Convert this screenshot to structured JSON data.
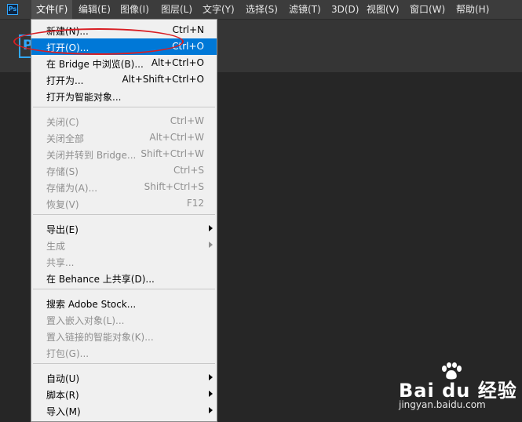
{
  "menubar": {
    "logo": "Ps",
    "items": [
      "文件(F)",
      "编辑(E)",
      "图像(I)",
      "图层(L)",
      "文字(Y)",
      "选择(S)",
      "滤镜(T)",
      "3D(D)",
      "视图(V)",
      "窗口(W)",
      "帮助(H)"
    ]
  },
  "home_icon_letter": "P",
  "file_menu": {
    "items": [
      {
        "label": "新建(N)...",
        "shortcut": "Ctrl+N",
        "state": "enabled"
      },
      {
        "label": "打开(O)...",
        "shortcut": "Ctrl+O",
        "state": "highlighted"
      },
      {
        "label": "在 Bridge 中浏览(B)...",
        "shortcut": "Alt+Ctrl+O",
        "state": "enabled"
      },
      {
        "label": "打开为...",
        "shortcut": "Alt+Shift+Ctrl+O",
        "state": "enabled"
      },
      {
        "label": "打开为智能对象...",
        "shortcut": "",
        "state": "enabled"
      },
      {
        "label": "关闭(C)",
        "shortcut": "Ctrl+W",
        "state": "disabled"
      },
      {
        "label": "关闭全部",
        "shortcut": "Alt+Ctrl+W",
        "state": "disabled"
      },
      {
        "label": "关闭并转到 Bridge...",
        "shortcut": "Shift+Ctrl+W",
        "state": "disabled"
      },
      {
        "label": "存储(S)",
        "shortcut": "Ctrl+S",
        "state": "disabled"
      },
      {
        "label": "存储为(A)...",
        "shortcut": "Shift+Ctrl+S",
        "state": "disabled"
      },
      {
        "label": "恢复(V)",
        "shortcut": "F12",
        "state": "disabled"
      },
      {
        "label": "导出(E)",
        "shortcut": "",
        "state": "enabled",
        "submenu": true
      },
      {
        "label": "生成",
        "shortcut": "",
        "state": "disabled",
        "submenu": true
      },
      {
        "label": "共享...",
        "shortcut": "",
        "state": "disabled"
      },
      {
        "label": "在 Behance 上共享(D)...",
        "shortcut": "",
        "state": "enabled"
      },
      {
        "label": "搜索 Adobe Stock...",
        "shortcut": "",
        "state": "enabled"
      },
      {
        "label": "置入嵌入对象(L)...",
        "shortcut": "",
        "state": "disabled"
      },
      {
        "label": "置入链接的智能对象(K)...",
        "shortcut": "",
        "state": "disabled"
      },
      {
        "label": "打包(G)...",
        "shortcut": "",
        "state": "disabled"
      },
      {
        "label": "自动(U)",
        "shortcut": "",
        "state": "enabled",
        "submenu": true
      },
      {
        "label": "脚本(R)",
        "shortcut": "",
        "state": "enabled",
        "submenu": true
      },
      {
        "label": "导入(M)",
        "shortcut": "",
        "state": "enabled",
        "submenu": true
      }
    ]
  },
  "watermark": {
    "brand": "Bai du 经验",
    "url": "jingyan.baidu.com"
  },
  "colors": {
    "highlight": "#0078d7",
    "annotation": "#d81e24",
    "ps_blue": "#31a8ff"
  }
}
